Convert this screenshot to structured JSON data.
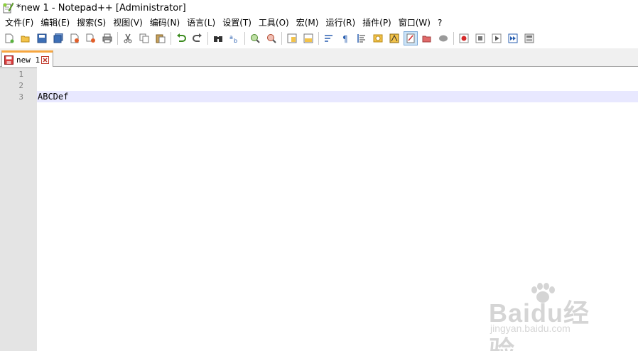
{
  "window": {
    "title": "*new 1 - Notepad++ [Administrator]"
  },
  "menu": [
    {
      "name": "file",
      "label": "文件(F)"
    },
    {
      "name": "edit",
      "label": "编辑(E)"
    },
    {
      "name": "search",
      "label": "搜索(S)"
    },
    {
      "name": "view",
      "label": "视图(V)"
    },
    {
      "name": "encoding",
      "label": "编码(N)"
    },
    {
      "name": "language",
      "label": "语言(L)"
    },
    {
      "name": "settings",
      "label": "设置(T)"
    },
    {
      "name": "tools",
      "label": "工具(O)"
    },
    {
      "name": "macro",
      "label": "宏(M)"
    },
    {
      "name": "run",
      "label": "运行(R)"
    },
    {
      "name": "plugins",
      "label": "插件(P)"
    },
    {
      "name": "window",
      "label": "窗口(W)"
    },
    {
      "name": "help",
      "label": "?"
    }
  ],
  "toolbar": {
    "icons": [
      "new-file-icon",
      "open-file-icon",
      "save-icon",
      "save-all-icon",
      "close-icon",
      "close-all-icon",
      "print-icon",
      "cut-icon",
      "copy-icon",
      "paste-icon",
      "undo-icon",
      "redo-icon",
      "find-icon",
      "replace-icon",
      "zoom-in-icon",
      "zoom-out-icon",
      "sync-vertical-icon",
      "sync-horizontal-icon",
      "word-wrap-icon",
      "show-all-characters-icon",
      "indent-guide-icon",
      "document-map-icon",
      "function-list-icon",
      "folder-as-workspace-icon",
      "monitoring-icon",
      "record-macro-icon",
      "stop-recording-icon",
      "play-macro-icon",
      "run-macro-multiple-icon",
      "save-macro-icon"
    ],
    "active_icon": "folder-as-workspace-icon"
  },
  "tabs": [
    {
      "label": "new 1",
      "modified": true
    }
  ],
  "editor": {
    "lines": [
      {
        "number": "1",
        "text": ""
      },
      {
        "number": "2",
        "text": ""
      },
      {
        "number": "3",
        "text": "ABCDef"
      }
    ],
    "current_line": 3
  },
  "watermark": {
    "brand": "Baidu经验",
    "url": "jingyan.baidu.com"
  },
  "colors": {
    "tab_accent": "#f7a640",
    "current_line_bg": "#e8e8ff",
    "gutter_bg": "#e4e4e4"
  }
}
